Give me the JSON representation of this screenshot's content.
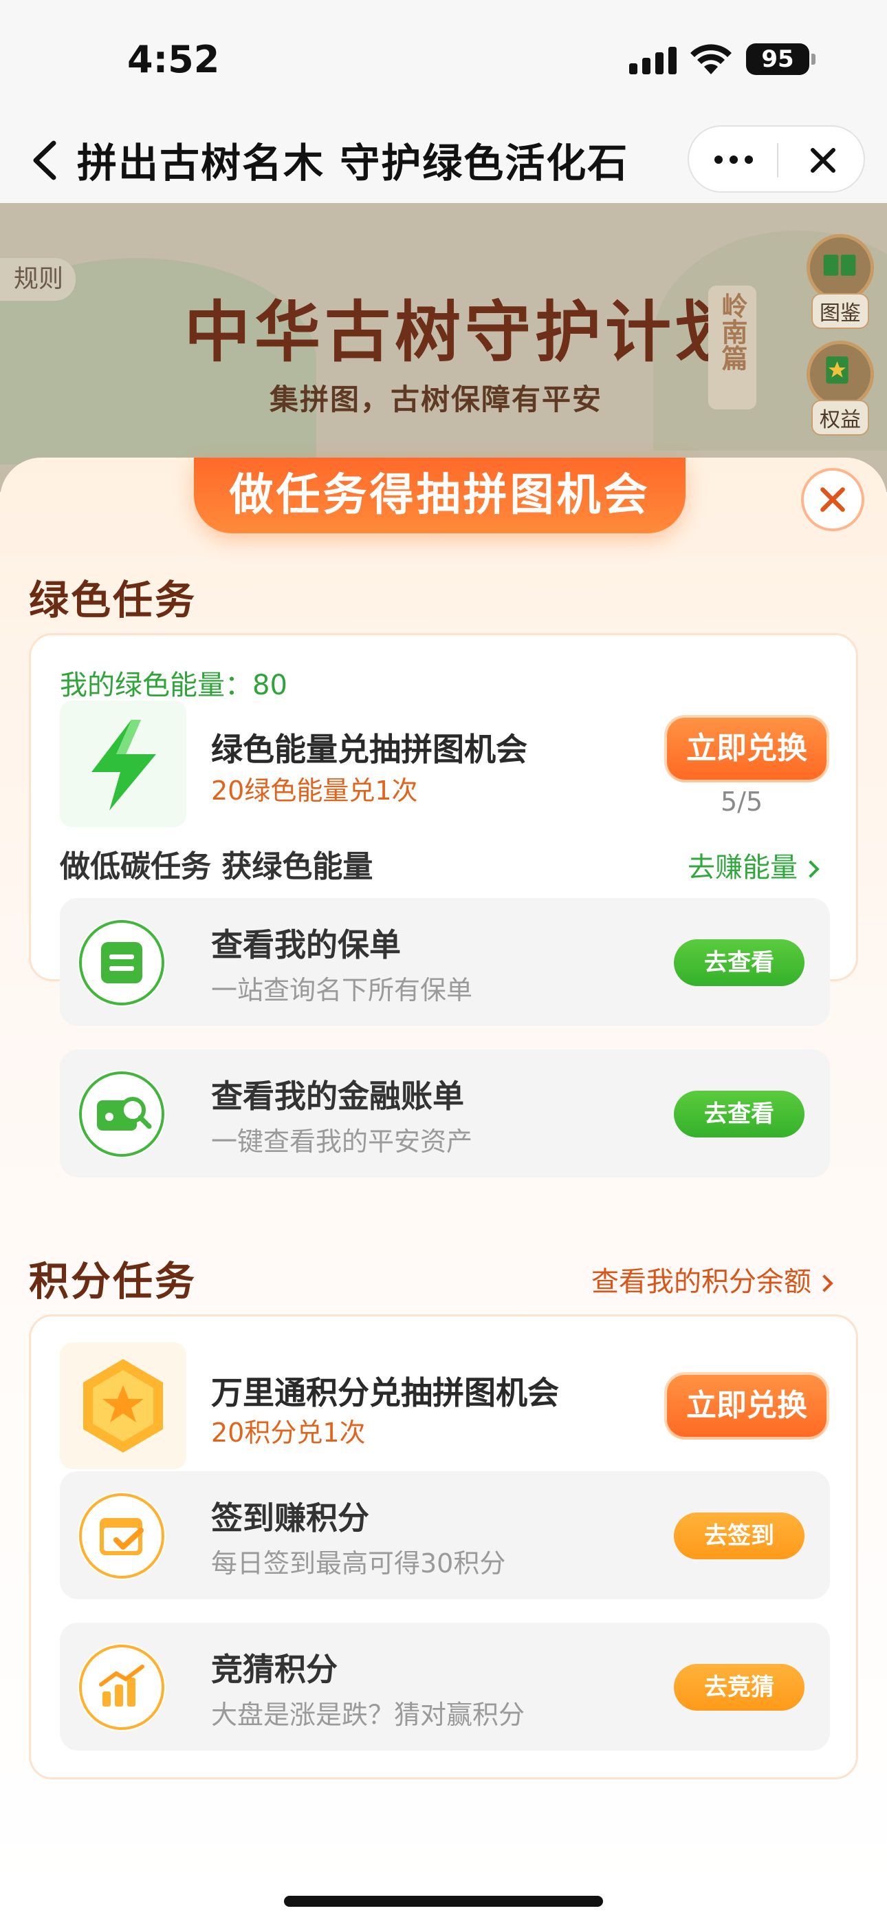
{
  "status_bar": {
    "time": "4:52",
    "battery": "95"
  },
  "nav": {
    "title": "拼出古树名木 守护绿色活化石"
  },
  "banner": {
    "rules": "规则",
    "title": "中华古树守护计划",
    "subtitle": "集拼图，古树保障有平安",
    "vertical_tag": "岭南篇",
    "side_buttons": [
      {
        "label": "图鉴",
        "icon": "book-icon"
      },
      {
        "label": "权益",
        "icon": "star-badge-icon"
      }
    ]
  },
  "modal": {
    "header": "做任务得抽拼图机会",
    "green_section": {
      "title": "绿色任务",
      "energy_label": "我的绿色能量：80",
      "exchange": {
        "title": "绿色能量兑抽拼图机会",
        "subtitle": "20绿色能量兑1次",
        "button": "立即兑换",
        "count": "5/5"
      },
      "subheading": "做低碳任务 获绿色能量",
      "earn_link": "去赚能量",
      "tasks": [
        {
          "title": "查看我的保单",
          "desc": "一站查询名下所有保单",
          "button": "去查看",
          "icon": "policy-icon"
        },
        {
          "title": "查看我的金融账单",
          "desc": "一键查看我的平安资产",
          "button": "去查看",
          "icon": "bill-search-icon"
        }
      ]
    },
    "points_section": {
      "title": "积分任务",
      "link": "查看我的积分余额",
      "exchange": {
        "title": "万里通积分兑抽拼图机会",
        "subtitle": "20积分兑1次",
        "button": "立即兑换"
      },
      "tasks": [
        {
          "title": "签到赚积分",
          "desc": "每日签到最高可得30积分",
          "button": "去签到",
          "icon": "calendar-check-icon"
        },
        {
          "title": "竞猜积分",
          "desc": "大盘是涨是跌？猜对赢积分",
          "button": "去竞猜",
          "icon": "bar-chart-icon"
        }
      ]
    }
  },
  "colors": {
    "primary_orange": "#ff6a24",
    "green": "#35b12b",
    "brown_title": "#6a2c12"
  }
}
